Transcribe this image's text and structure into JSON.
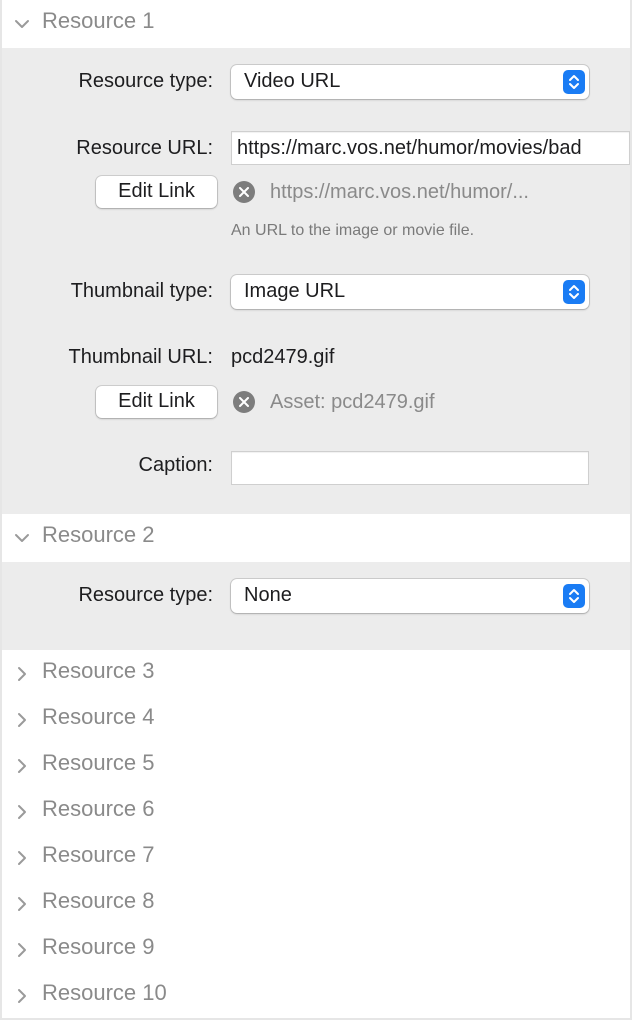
{
  "resource1": {
    "title": "Resource 1",
    "resource_type_label": "Resource type:",
    "resource_type_value": "Video URL",
    "resource_url_label": "Resource URL:",
    "resource_url_value": "https://marc.vos.net/humor/movies/bad",
    "edit_link_label": "Edit Link",
    "resource_link_text": "https://marc.vos.net/humor/...",
    "resource_url_hint": "An URL to the image or movie file.",
    "thumbnail_type_label": "Thumbnail type:",
    "thumbnail_type_value": "Image URL",
    "thumbnail_url_label": "Thumbnail URL:",
    "thumbnail_url_value": "pcd2479.gif",
    "thumbnail_link_text": "Asset: pcd2479.gif",
    "caption_label": "Caption:",
    "caption_value": ""
  },
  "resource2": {
    "title": "Resource 2",
    "resource_type_label": "Resource type:",
    "resource_type_value": "None"
  },
  "collapsed": [
    "Resource 3",
    "Resource 4",
    "Resource 5",
    "Resource 6",
    "Resource 7",
    "Resource 8",
    "Resource 9",
    "Resource 10"
  ],
  "colors": {
    "panel_bg": "#ececec",
    "accent": "#1a7cf4",
    "secondary_text": "#8a8a8a"
  },
  "icons": {
    "expanded": "chevron-down-icon",
    "collapsed": "chevron-right-icon",
    "clear": "clear-icon",
    "stepper": "popup-stepper-icon"
  }
}
